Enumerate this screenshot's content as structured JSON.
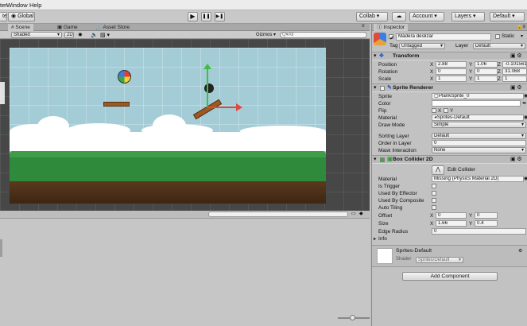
{
  "menu": {
    "items": [
      "ter",
      "Window",
      "Help"
    ]
  },
  "toolbar": {
    "global_label": "Global",
    "play": "▶",
    "pause": "❚❚",
    "step": "▶❚",
    "collab_label": "Collab ▾",
    "account_label": "Account",
    "layers_label": "Layers",
    "layout_label": "Default"
  },
  "scene": {
    "tabs": [
      "Scene",
      "Game",
      "Asset Store"
    ],
    "shading": "Shaded",
    "mode_2d": "2D",
    "gizmos": "Gizmos",
    "search_placeholder": "All"
  },
  "inspector": {
    "tab": "Inspector",
    "object_name": "Madera deslizar",
    "static_label": "Static",
    "tag_label": "Tag",
    "tag_value": "Untagged",
    "layer_label": "Layer",
    "layer_value": "Default",
    "transform": {
      "title": "Transform",
      "position_label": "Position",
      "position": [
        "2.88",
        "1.06",
        "-0.101561"
      ],
      "rotation_label": "Rotation",
      "rotation": [
        "0",
        "0",
        "31.068"
      ],
      "scale_label": "Scale",
      "scale": [
        "1",
        "1",
        "1"
      ]
    },
    "sprite_renderer": {
      "title": "Sprite Renderer",
      "sprite_label": "Sprite",
      "sprite_value": "PlankSprite_0",
      "color_label": "Color",
      "flip_label": "Flip",
      "flip_x": "X",
      "flip_y": "Y",
      "material_label": "Material",
      "material_value": "Sprites-Default",
      "draw_mode_label": "Draw Mode",
      "draw_mode_value": "Simple",
      "sorting_layer_label": "Sorting Layer",
      "sorting_layer_value": "Default",
      "order_label": "Order in Layer",
      "order_value": "0",
      "mask_label": "Mask Interaction",
      "mask_value": "None"
    },
    "box_collider": {
      "title": "Box Collider 2D",
      "edit_label": "Edit Collider",
      "material_label": "Material",
      "material_value": "Missing (Physics Material 2D)",
      "trigger_label": "Is Trigger",
      "effector_label": "Used By Effector",
      "composite_label": "Used By Composite",
      "autotiling_label": "Auto Tiling",
      "offset_label": "Offset",
      "offset": [
        "0",
        "0"
      ],
      "size_label": "Size",
      "size": [
        "1.66",
        "0.4"
      ],
      "edge_label": "Edge Radius",
      "edge_value": "0",
      "info_label": "Info"
    },
    "material_preview": {
      "name": "Sprites-Default",
      "shader_label": "Shader",
      "shader_value": "Sprites/Default"
    },
    "add_component": "Add Component"
  },
  "axis_x": "X",
  "axis_y": "Y",
  "axis_z": "Z"
}
